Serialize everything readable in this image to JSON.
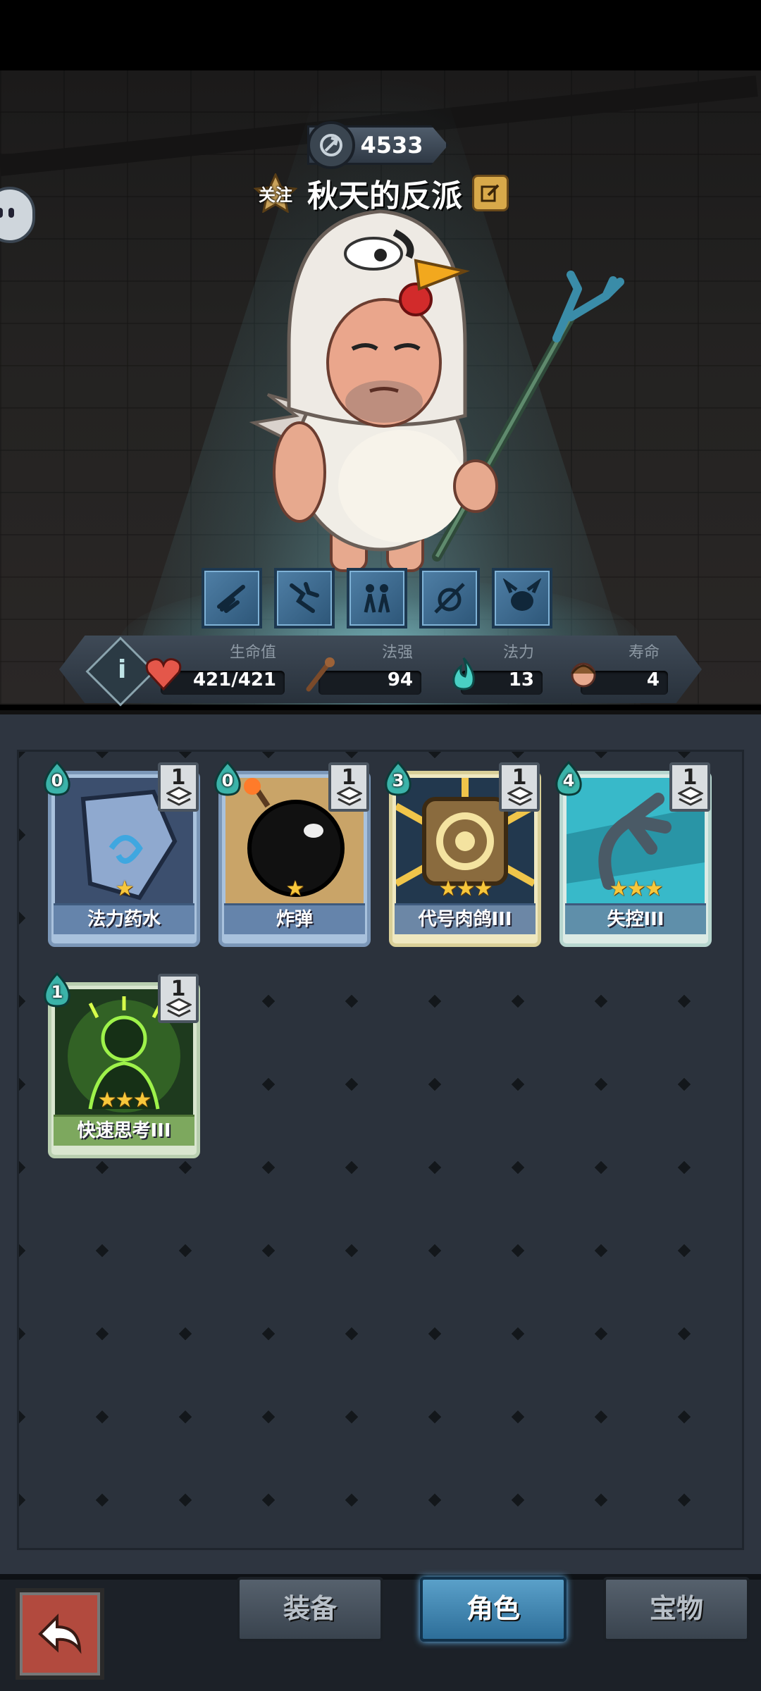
{
  "player": {
    "score": "4533",
    "follow_label": "关注",
    "name": "秋天的反派"
  },
  "skills": [
    {
      "icon": "broom-skill-icon"
    },
    {
      "icon": "crack-skill-icon"
    },
    {
      "icon": "twins-skill-icon"
    },
    {
      "icon": "target-skill-icon"
    },
    {
      "icon": "monster-skill-icon"
    }
  ],
  "stats": {
    "info_label": "i",
    "health": {
      "label": "生命值",
      "value": "421/421"
    },
    "power": {
      "label": "法强",
      "value": "94"
    },
    "mana": {
      "label": "法力",
      "value": "13"
    },
    "lifespan": {
      "label": "寿命",
      "value": "4"
    }
  },
  "cards": [
    {
      "name": "法力药水",
      "cost": "0",
      "stack": "1",
      "stars": "★",
      "rarity": "common",
      "art": "potion-art"
    },
    {
      "name": "炸弹",
      "cost": "0",
      "stack": "1",
      "stars": "★",
      "rarity": "common",
      "art": "bomb-art"
    },
    {
      "name": "代号肉鸽III",
      "cost": "3",
      "stack": "1",
      "stars": "★★★",
      "rarity": "rare",
      "art": "sun-disc-art"
    },
    {
      "name": "失控III",
      "cost": "4",
      "stack": "1",
      "stars": "★★★",
      "rarity": "teal",
      "art": "claw-art"
    },
    {
      "name": "快速思考III",
      "cost": "1",
      "stack": "1",
      "stars": "★★★",
      "rarity": "green",
      "art": "thinker-art"
    }
  ],
  "nav": {
    "back_icon": "back-arrow-icon",
    "tabs": [
      {
        "label": "装备",
        "active": false
      },
      {
        "label": "角色",
        "active": true
      },
      {
        "label": "宝物",
        "active": false
      }
    ]
  },
  "colors": {
    "accent_blue": "#2d6e99",
    "back_red": "#b24a3e",
    "star_gold": "#f7c73b"
  }
}
